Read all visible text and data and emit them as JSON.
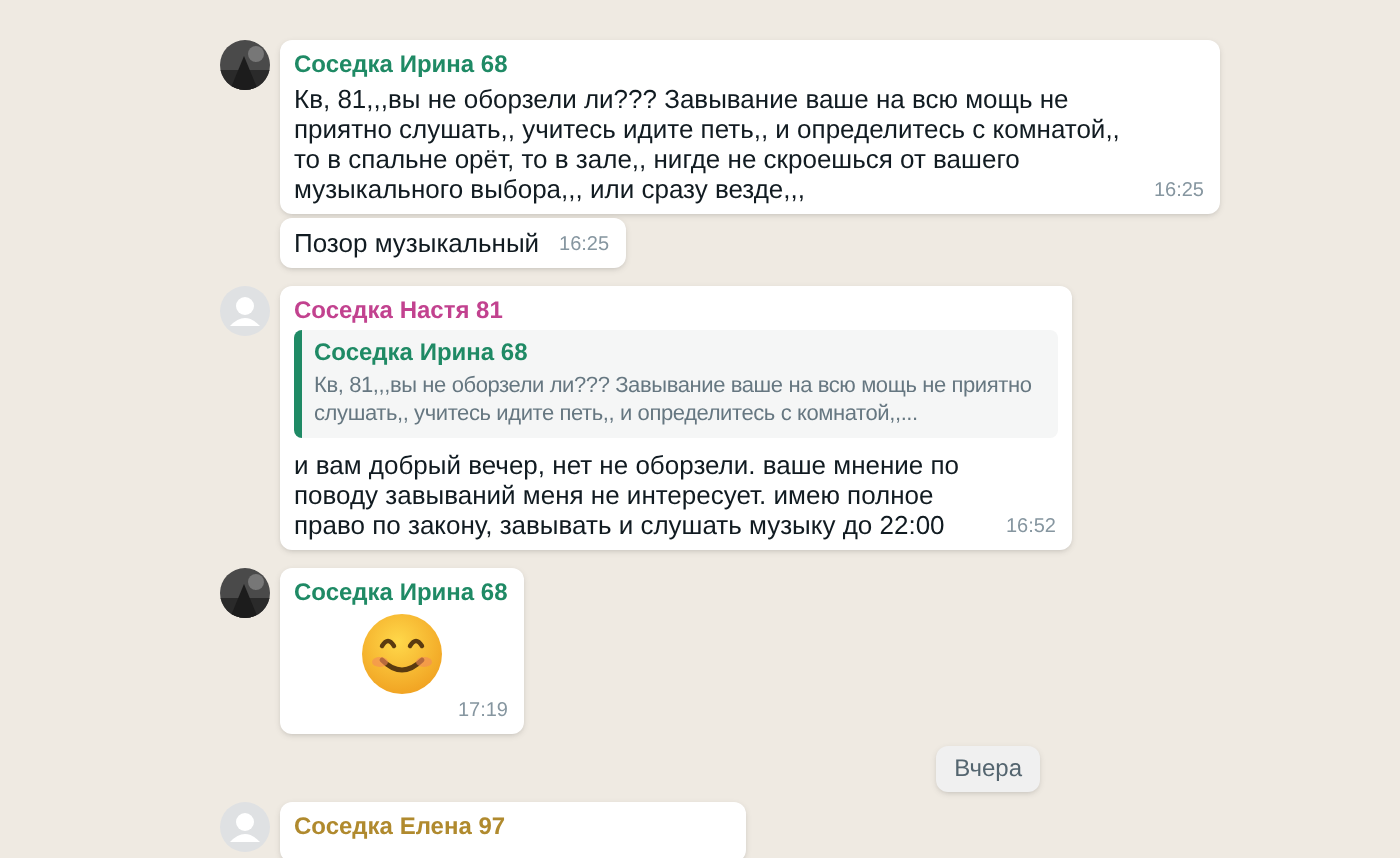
{
  "messages": [
    {
      "kind": "text",
      "photo_avatar": true,
      "sender": "Соседка Ирина 68",
      "color": "#1f8a65",
      "text": "Кв, 81,,,вы не оборзели ли??? Завывание ваше на всю мощь не приятно слушать,, учитесь идите петь,, и определитесь с комнатой,, то в спальне орёт, то в зале,, нигде не скроешься от вашего музыкального выбора,,, или сразу везде,,,",
      "time": "16:25"
    },
    {
      "kind": "text",
      "text": "Позор музыкальный",
      "time": "16:25"
    },
    {
      "kind": "text",
      "photo_avatar": false,
      "sender": "Соседка Настя 81",
      "color": "#c2428f",
      "quote": {
        "sender": "Соседка Ирина 68",
        "color": "#1f8a65",
        "text": "Кв, 81,,,вы не оборзели ли??? Завывание ваше на всю мощь не приятно слушать,, учитесь идите петь,, и определитесь с комнатой,,..."
      },
      "text": "и вам добрый вечер, нет не оборзели. ваше мнение по поводу завываний меня не интересует. имею полное право по закону, завывать и слушать музыку до 22:00",
      "time": "16:52"
    },
    {
      "kind": "emoji",
      "photo_avatar": true,
      "sender": "Соседка Ирина 68",
      "color": "#1f8a65",
      "time": "17:19"
    },
    {
      "kind": "date",
      "text": "Вчера"
    },
    {
      "kind": "text",
      "photo_avatar": false,
      "sender": "Соседка Елена 97",
      "color": "#b08a2e"
    }
  ]
}
